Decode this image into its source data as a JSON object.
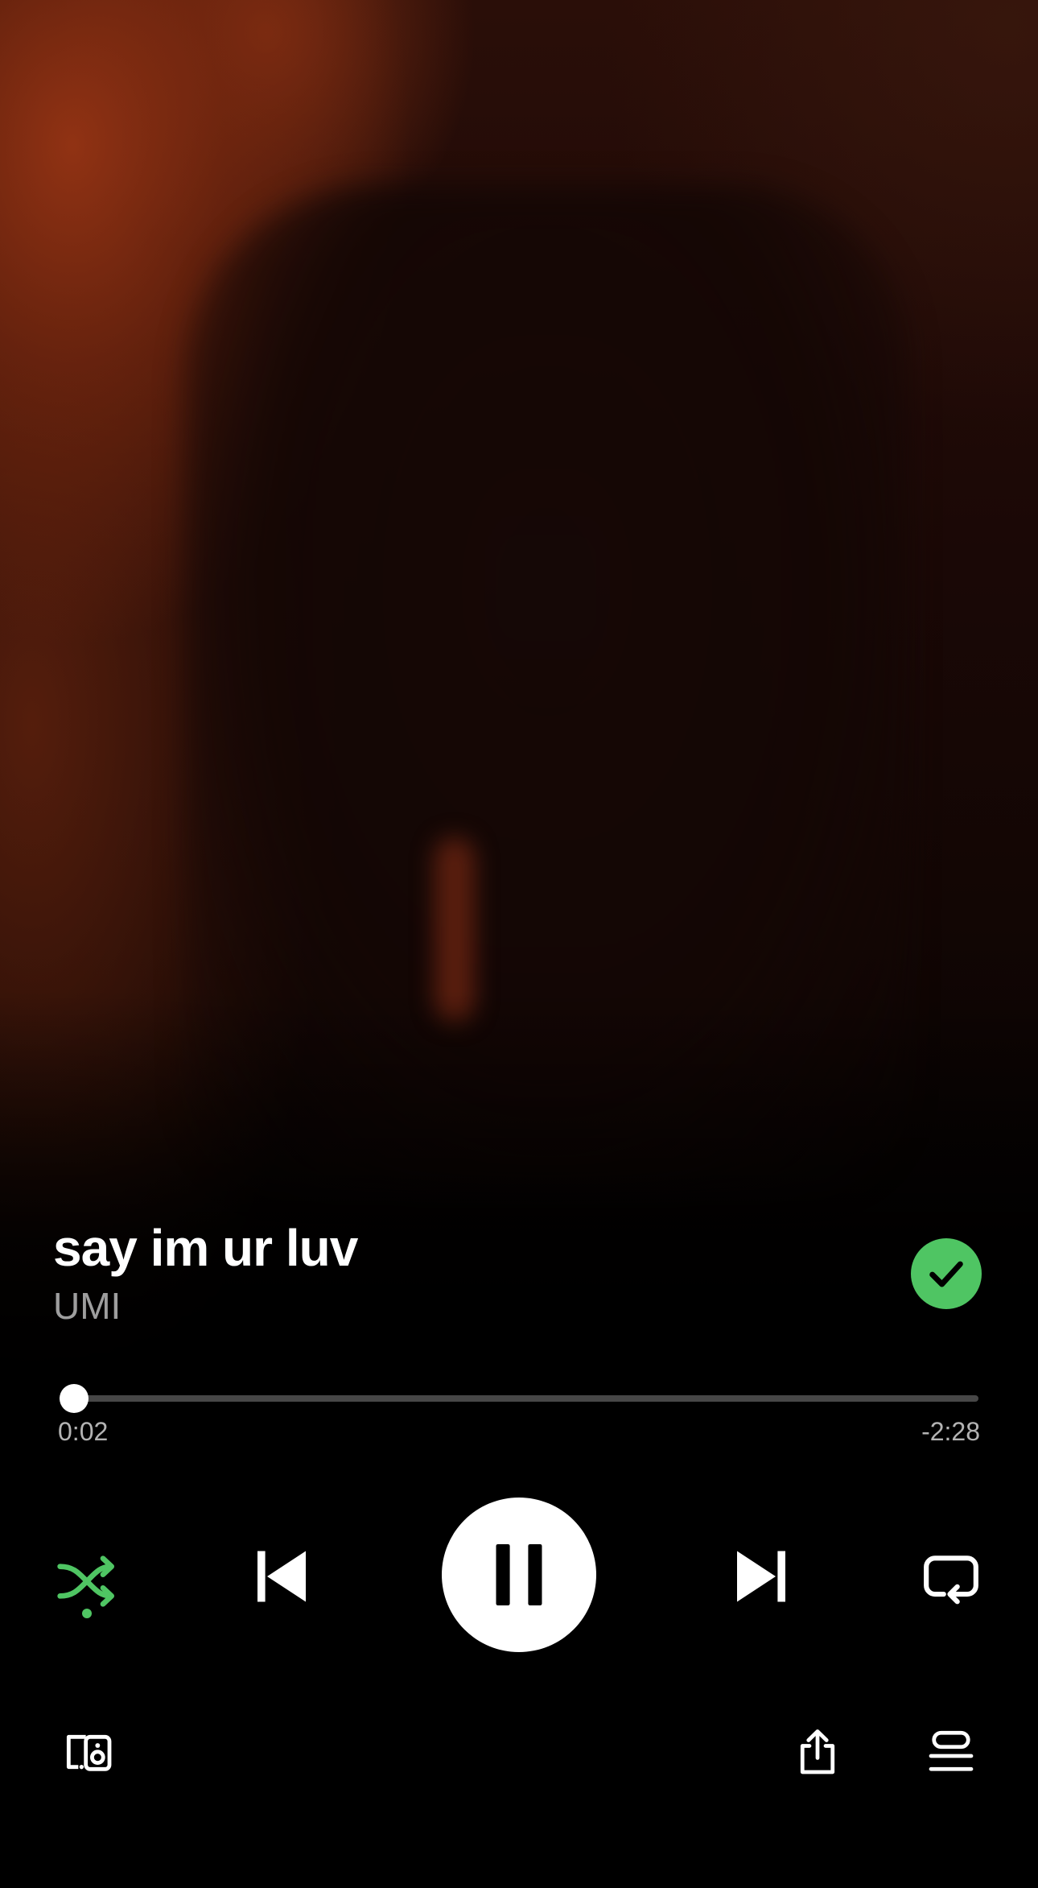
{
  "track": {
    "title": "say im ur luv",
    "artist": "UMI",
    "saved": true
  },
  "playback": {
    "elapsed": "0:02",
    "remaining": "-2:28",
    "progress_fraction": 0.0133,
    "state": "playing",
    "shuffle": "on"
  },
  "colors": {
    "accent": "#4fc563",
    "background": "#000000",
    "text_primary": "#ffffff"
  },
  "icons": {
    "saved": "check-icon",
    "shuffle": "shuffle-icon",
    "previous": "skip-previous-icon",
    "play_pause": "pause-icon",
    "next": "skip-next-icon",
    "repeat": "repeat-icon",
    "devices": "connect-devices-icon",
    "share": "share-icon",
    "queue": "queue-icon"
  }
}
